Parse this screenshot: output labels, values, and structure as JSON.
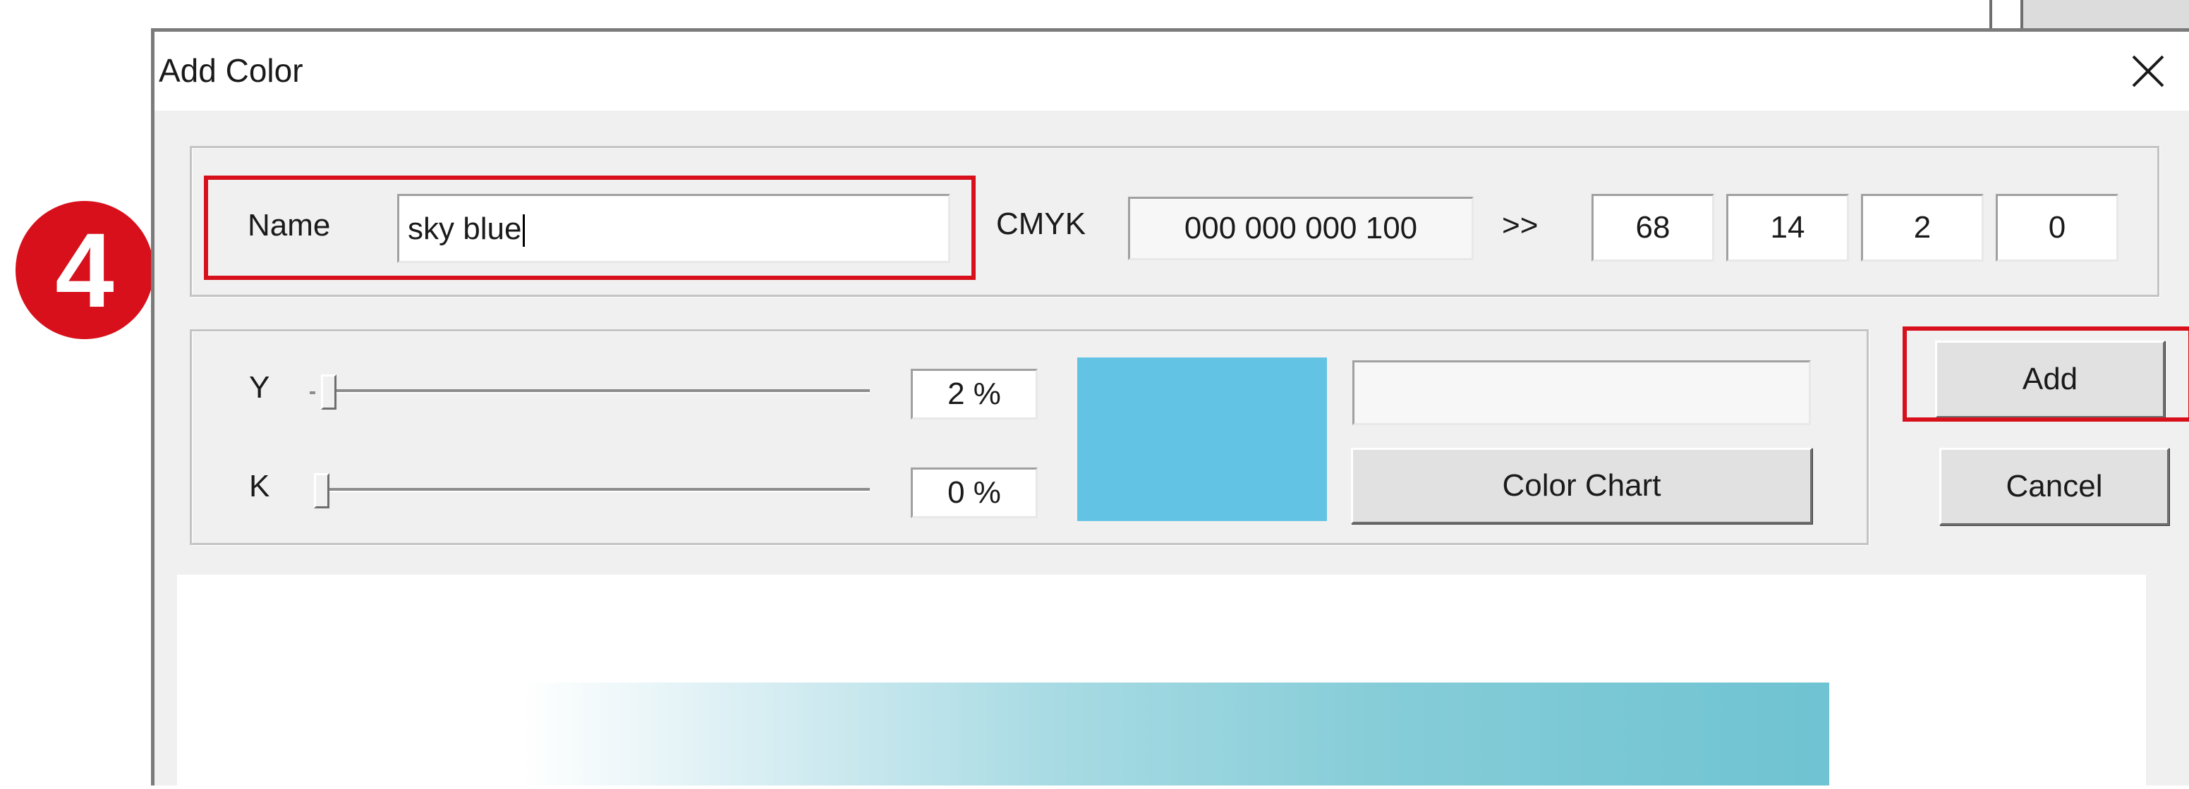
{
  "step_badge": "4",
  "dialog": {
    "title": "Add Color",
    "name_label": "Name",
    "name_value": "sky blue",
    "cmyk_label": "CMYK",
    "cmyk_readout": "000 000 000 100",
    "arrow_label": ">>",
    "cmyk_values": [
      "68",
      "14",
      "2",
      "0"
    ],
    "sliders": [
      {
        "label": "Y",
        "value_text": "2 %",
        "level_percent": 2
      },
      {
        "label": "K",
        "value_text": "0 %",
        "level_percent": 0
      }
    ],
    "swatch_color": "#63c3e4",
    "color_chart_button": "Color Chart",
    "add_button": "Add",
    "cancel_button": "Cancel"
  },
  "colors": {
    "highlight": "#d7101b",
    "dialog_bg": "#f0f0f0"
  }
}
